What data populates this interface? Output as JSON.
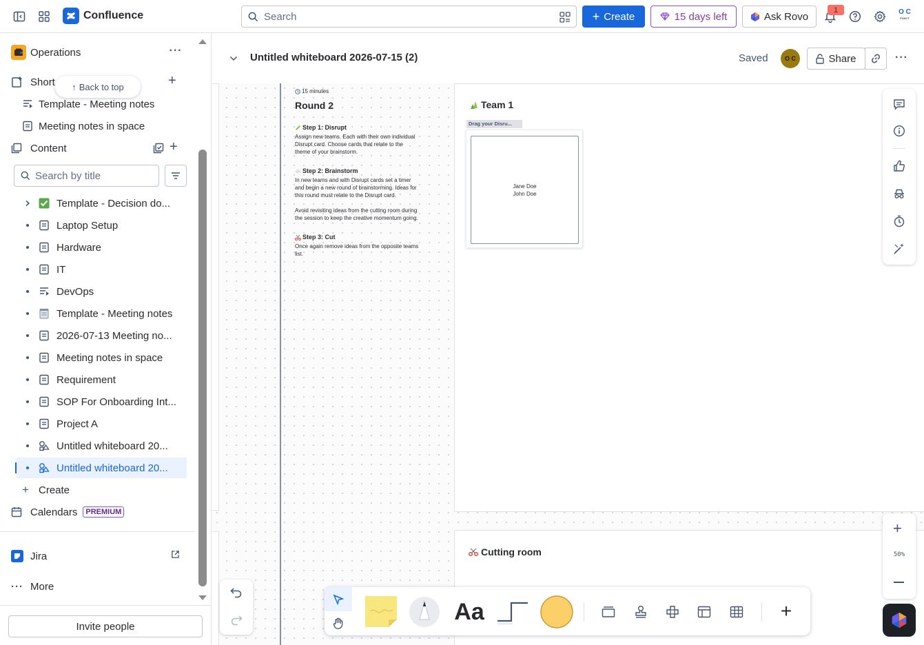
{
  "app": {
    "name": "Confluence"
  },
  "topnav": {
    "search_placeholder": "Search",
    "create_label": "Create",
    "trial_label": "15 days left",
    "rovo_label": "Ask Rovo",
    "notification_count": "1",
    "avatar_initials_top": "O C",
    "avatar_initials_bottom": "FUNCT"
  },
  "sidebar": {
    "space_name": "Operations",
    "shortcuts_label": "Short",
    "back_to_top": "Back to top",
    "shortcuts": [
      "Template - Meeting notes",
      "Meeting notes in space"
    ],
    "content_label": "Content",
    "search_placeholder": "Search by title",
    "tree": [
      {
        "label": "Template - Decision do...",
        "icon": "checkbox-emoji-icon"
      },
      {
        "label": "Laptop Setup",
        "icon": "page-icon"
      },
      {
        "label": "Hardware",
        "icon": "page-icon"
      },
      {
        "label": "IT",
        "icon": "page-icon"
      },
      {
        "label": "DevOps",
        "icon": "live-doc-icon"
      },
      {
        "label": "Template - Meeting notes",
        "icon": "notepad-emoji-icon"
      },
      {
        "label": "2026-07-13 Meeting no...",
        "icon": "page-icon"
      },
      {
        "label": "Meeting notes in space",
        "icon": "page-icon"
      },
      {
        "label": "Requirement",
        "icon": "page-icon"
      },
      {
        "label": "SOP For Onboarding Int...",
        "icon": "page-icon"
      },
      {
        "label": "Project A",
        "icon": "page-icon"
      },
      {
        "label": "Untitled whiteboard 20...",
        "icon": "whiteboard-icon"
      },
      {
        "label": "Untitled whiteboard 20...",
        "icon": "whiteboard-icon"
      }
    ],
    "create_label": "Create",
    "calendars_label": "Calendars",
    "premium_badge": "PREMIUM",
    "jira_label": "Jira",
    "more_label": "More",
    "invite_label": "Invite people"
  },
  "header": {
    "title": "Untitled whiteboard 2026-07-15 (2)",
    "status": "Saved",
    "avatar_initials": "O C",
    "share_label": "Share"
  },
  "canvas": {
    "round": {
      "time": "15 minutes",
      "title": "Round 2",
      "step1_title": "Step 1: Disrupt",
      "step1_text": "Assign new teams. Each with their own individual Disrupt card. Choose cards that relate to the theme of your brainstorm.",
      "step2_title": "Step 2: Brainstorm",
      "step2_text": "In new teams and with Disrupt cards set a timer and begin a new round of brainstorming. Ideas for this round must relate to the Disrupt card.",
      "step2_text_b": "Avoid revisiting ideas from the cutting room during the session to keep the creative momentum going.",
      "step3_title": "Step 3: Cut",
      "step3_text": "Once again remove ideas from the opposite teams list."
    },
    "team": {
      "title": "Team 1",
      "drag_label": "Drag your Disru...",
      "members": [
        "Jane Doe",
        "John Doe"
      ]
    },
    "cutting_room": "Cutting room",
    "zoom_level": "50%"
  },
  "colors": {
    "brand": "#1868db",
    "sticky": "#f8e77f",
    "shape": "#fcd068",
    "active_bg": "#e9f2fe"
  }
}
